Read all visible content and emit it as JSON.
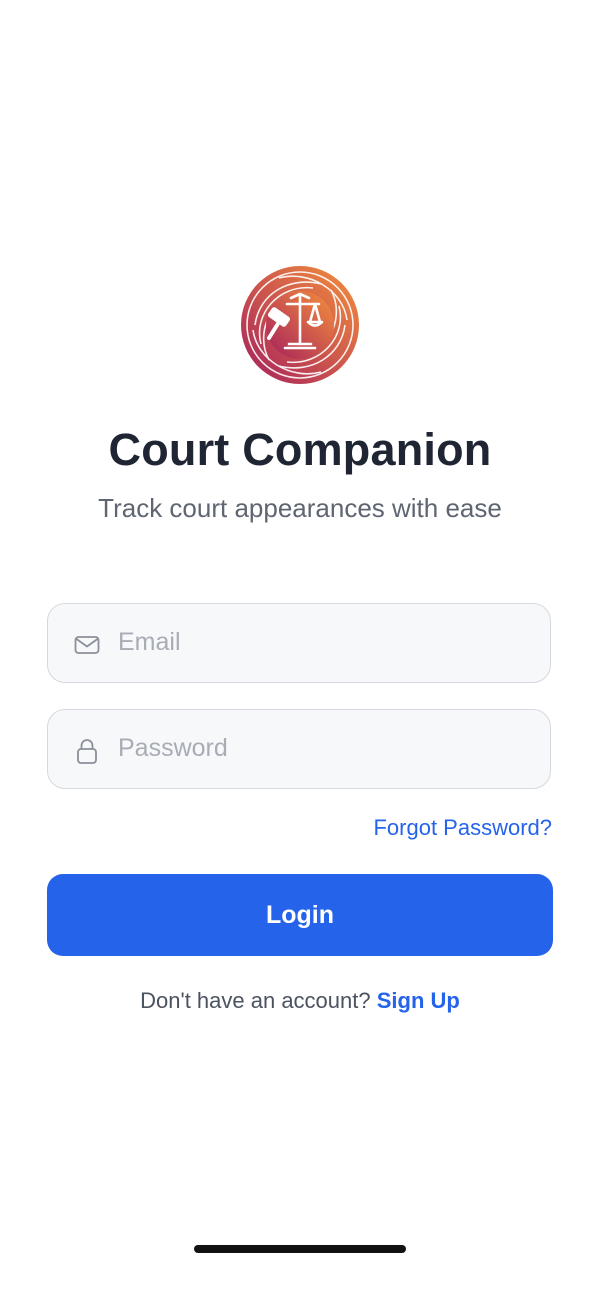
{
  "app": {
    "title": "Court Companion",
    "subtitle": "Track court appearances with ease"
  },
  "logo": {
    "icon": "scales-of-justice-gavel-emblem",
    "gradient": [
      "#b0275f",
      "#f28b3c"
    ]
  },
  "form": {
    "email": {
      "icon": "mail-icon",
      "placeholder": "Email",
      "value": ""
    },
    "password": {
      "icon": "lock-icon",
      "placeholder": "Password",
      "value": ""
    },
    "forgot_label": "Forgot Password?",
    "login_label": "Login"
  },
  "signup": {
    "prompt": "Don't have an account?",
    "link_label": "Sign Up"
  },
  "colors": {
    "accent": "#2563eb",
    "title": "#1f2533",
    "subtitle": "#5f6672",
    "field_border": "#d5d9df",
    "field_background": "#f7f8fa"
  }
}
